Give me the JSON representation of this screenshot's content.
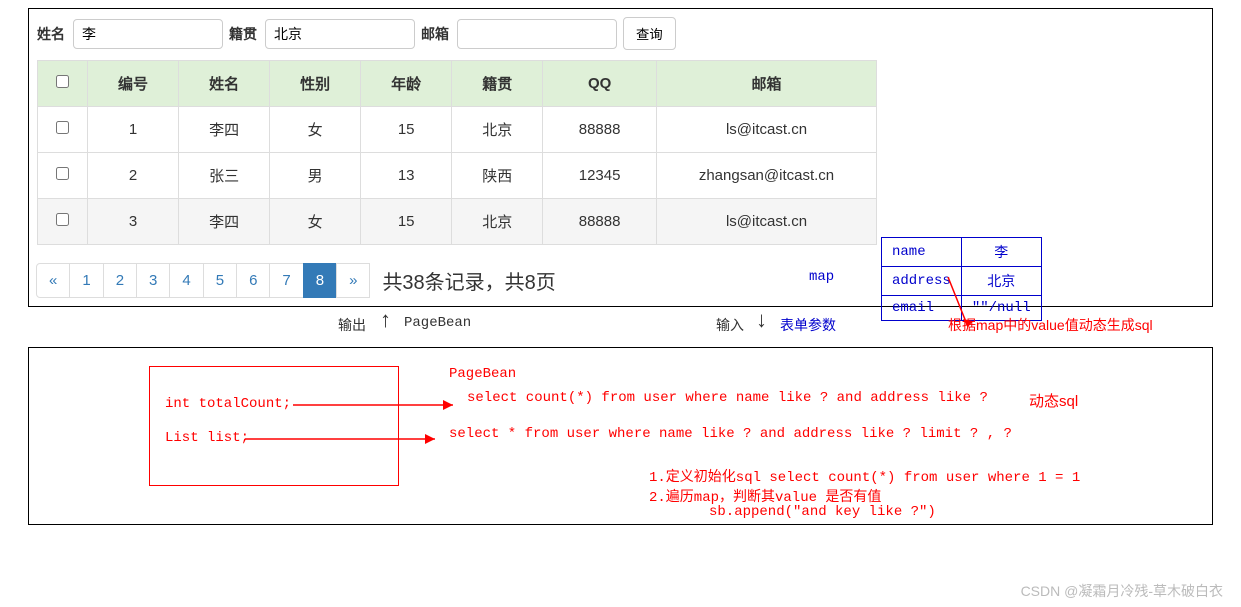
{
  "search": {
    "name_label": "姓名",
    "name_value": "李",
    "origin_label": "籍贯",
    "origin_value": "北京",
    "email_label": "邮箱",
    "email_value": "",
    "submit": "查询"
  },
  "table": {
    "headers": [
      "",
      "编号",
      "姓名",
      "性别",
      "年龄",
      "籍贯",
      "QQ",
      "邮箱"
    ],
    "rows": [
      {
        "id": "1",
        "name": "李四",
        "gender": "女",
        "age": "15",
        "origin": "北京",
        "qq": "88888",
        "email": "ls@itcast.cn"
      },
      {
        "id": "2",
        "name": "张三",
        "gender": "男",
        "age": "13",
        "origin": "陕西",
        "qq": "12345",
        "email": "zhangsan@itcast.cn"
      },
      {
        "id": "3",
        "name": "李四",
        "gender": "女",
        "age": "15",
        "origin": "北京",
        "qq": "88888",
        "email": "ls@itcast.cn"
      }
    ]
  },
  "pager": {
    "prev": "«",
    "pages": [
      "1",
      "2",
      "3",
      "4",
      "5",
      "6",
      "7",
      "8"
    ],
    "active": "8",
    "next": "»",
    "info": "共38条记录，共8页"
  },
  "map": {
    "label": "map",
    "rows": [
      {
        "k": "name",
        "v": "李"
      },
      {
        "k": "address",
        "v": "北京"
      },
      {
        "k": "email",
        "v": "\"\"/null"
      }
    ]
  },
  "labels": {
    "output": "输出",
    "pagebean": "PageBean",
    "input": "输入",
    "form_params": "表单参数"
  },
  "annot": {
    "pagebean_title": "PageBean",
    "total_count": "int totalCount;",
    "list": "List list;",
    "sql1": "select count(*) from user where name like ? and address like ?",
    "sql2": "select * from user where name like ? and address like ? limit ? , ?",
    "dynamic_sql": "动态sql",
    "map_note": "根据map中的value值动态生成sql",
    "step1": "1.定义初始化sql select count(*) from user where 1 = 1",
    "step2": "2.遍历map，判断其value 是否有值",
    "step3": "sb.append(\"and  key like ?\")"
  },
  "watermark": "CSDN @凝霜月冷残-草木破白衣"
}
